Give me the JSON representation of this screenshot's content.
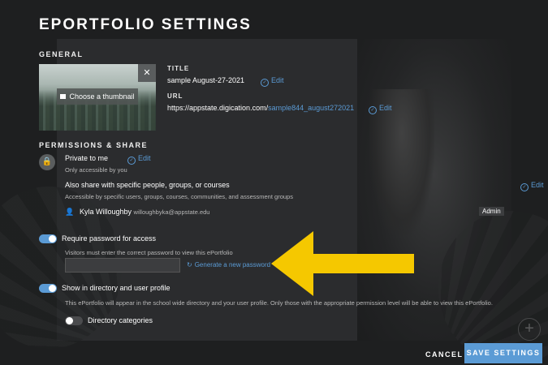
{
  "page": {
    "title": "EPORTFOLIO SETTINGS"
  },
  "general": {
    "section_title": "GENERAL",
    "thumbnail": {
      "choose_label": "Choose a thumbnail",
      "close_glyph": "✕"
    },
    "title_label": "TITLE",
    "title_value": "sample August-27-2021",
    "url_label": "URL",
    "url_prefix": "https://appstate.digication.com/",
    "url_slug": "sample844_august272021",
    "edit_label": "Edit"
  },
  "permissions": {
    "section_title": "PERMISSIONS & SHARE",
    "private_title": "Private to me",
    "private_sub": "Only accessible by you",
    "share_title": "Also share with specific people, groups, or courses",
    "share_sub": "Accessible by specific users, groups, courses, communities, and assessment groups",
    "user_name": "Kyla Willoughby",
    "user_email": "willoughbyka@appstate.edu",
    "user_role": "Admin",
    "edit_label": "Edit"
  },
  "password": {
    "toggle_label": "Require password for access",
    "toggle_state": "on",
    "hint": "Visitors must enter the correct password to view this ePortfolio",
    "input_value": "",
    "generate_label": "Generate a new password"
  },
  "directory": {
    "toggle_label": "Show in directory and user profile",
    "toggle_state": "on",
    "description": "This ePortfolio will appear in the school wide directory and your user profile. Only those with the appropriate permission level will be able to view this ePortfolio.",
    "categories_label": "Directory categories",
    "categories_state": "off"
  },
  "footer": {
    "cancel_label": "CANCEL",
    "save_label": "SAVE SETTINGS"
  },
  "colors": {
    "accent": "#5b9bd5",
    "arrow": "#f5c800",
    "background": "#1e1f20"
  }
}
